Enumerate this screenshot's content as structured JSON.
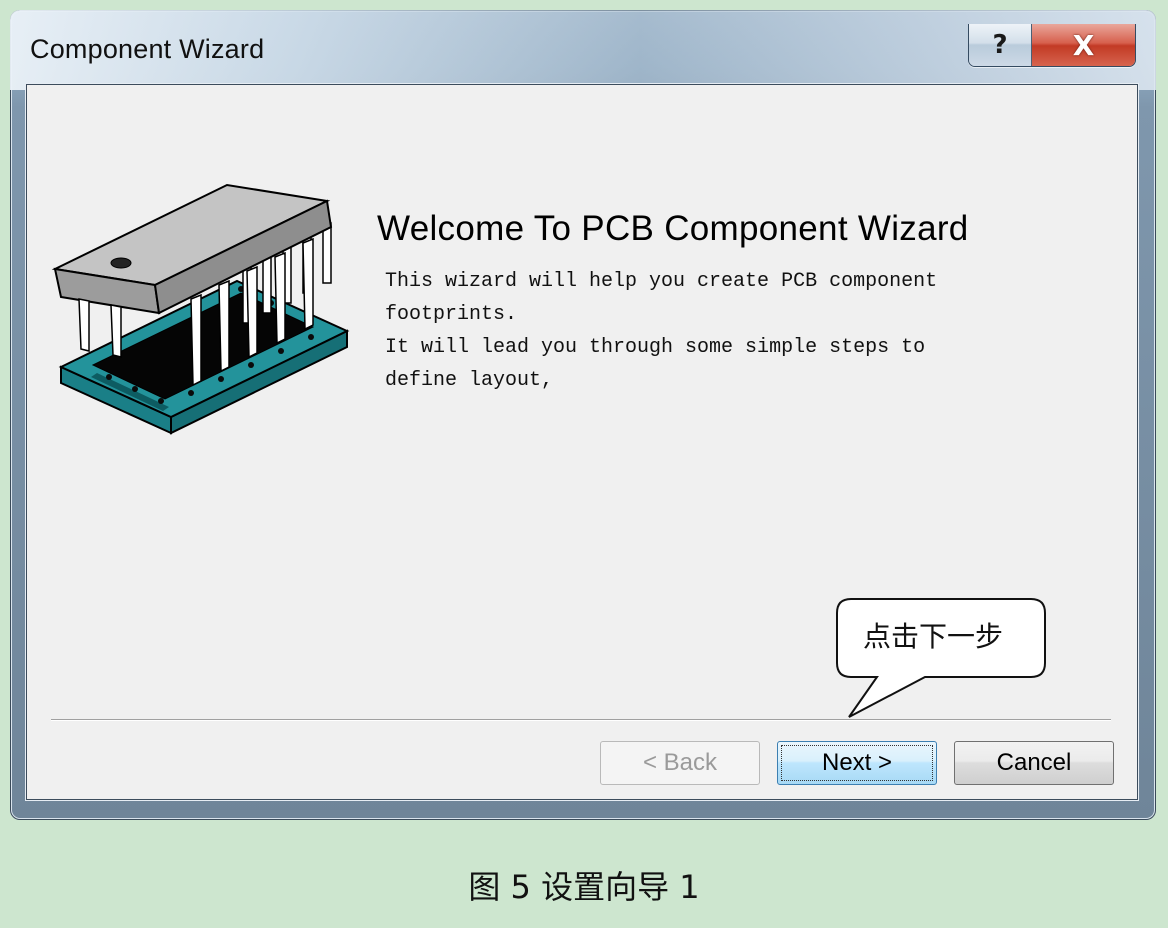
{
  "window": {
    "title": "Component Wizard",
    "help_glyph": "?",
    "close_glyph": "X"
  },
  "wizard": {
    "heading": "Welcome To PCB Component Wizard",
    "intro_lines": [
      "This wizard will help you create PCB component",
      "footprints.",
      "It will lead you through some simple steps to",
      "define layout,"
    ],
    "illustration_icon": "dip-chip-socket-icon"
  },
  "buttons": {
    "back_label": "< Back",
    "next_label": "Next >",
    "cancel_label": "Cancel",
    "back_enabled": false
  },
  "annotation": {
    "callout_text": "点击下一步"
  },
  "caption": "图 5  设置向导 1",
  "colors": {
    "page_background": "#cde6cf",
    "client_background": "#f0f0f0",
    "socket_teal": "#1e8c94",
    "chip_gray": "#b4b4b4",
    "close_red": "#c23a25"
  }
}
